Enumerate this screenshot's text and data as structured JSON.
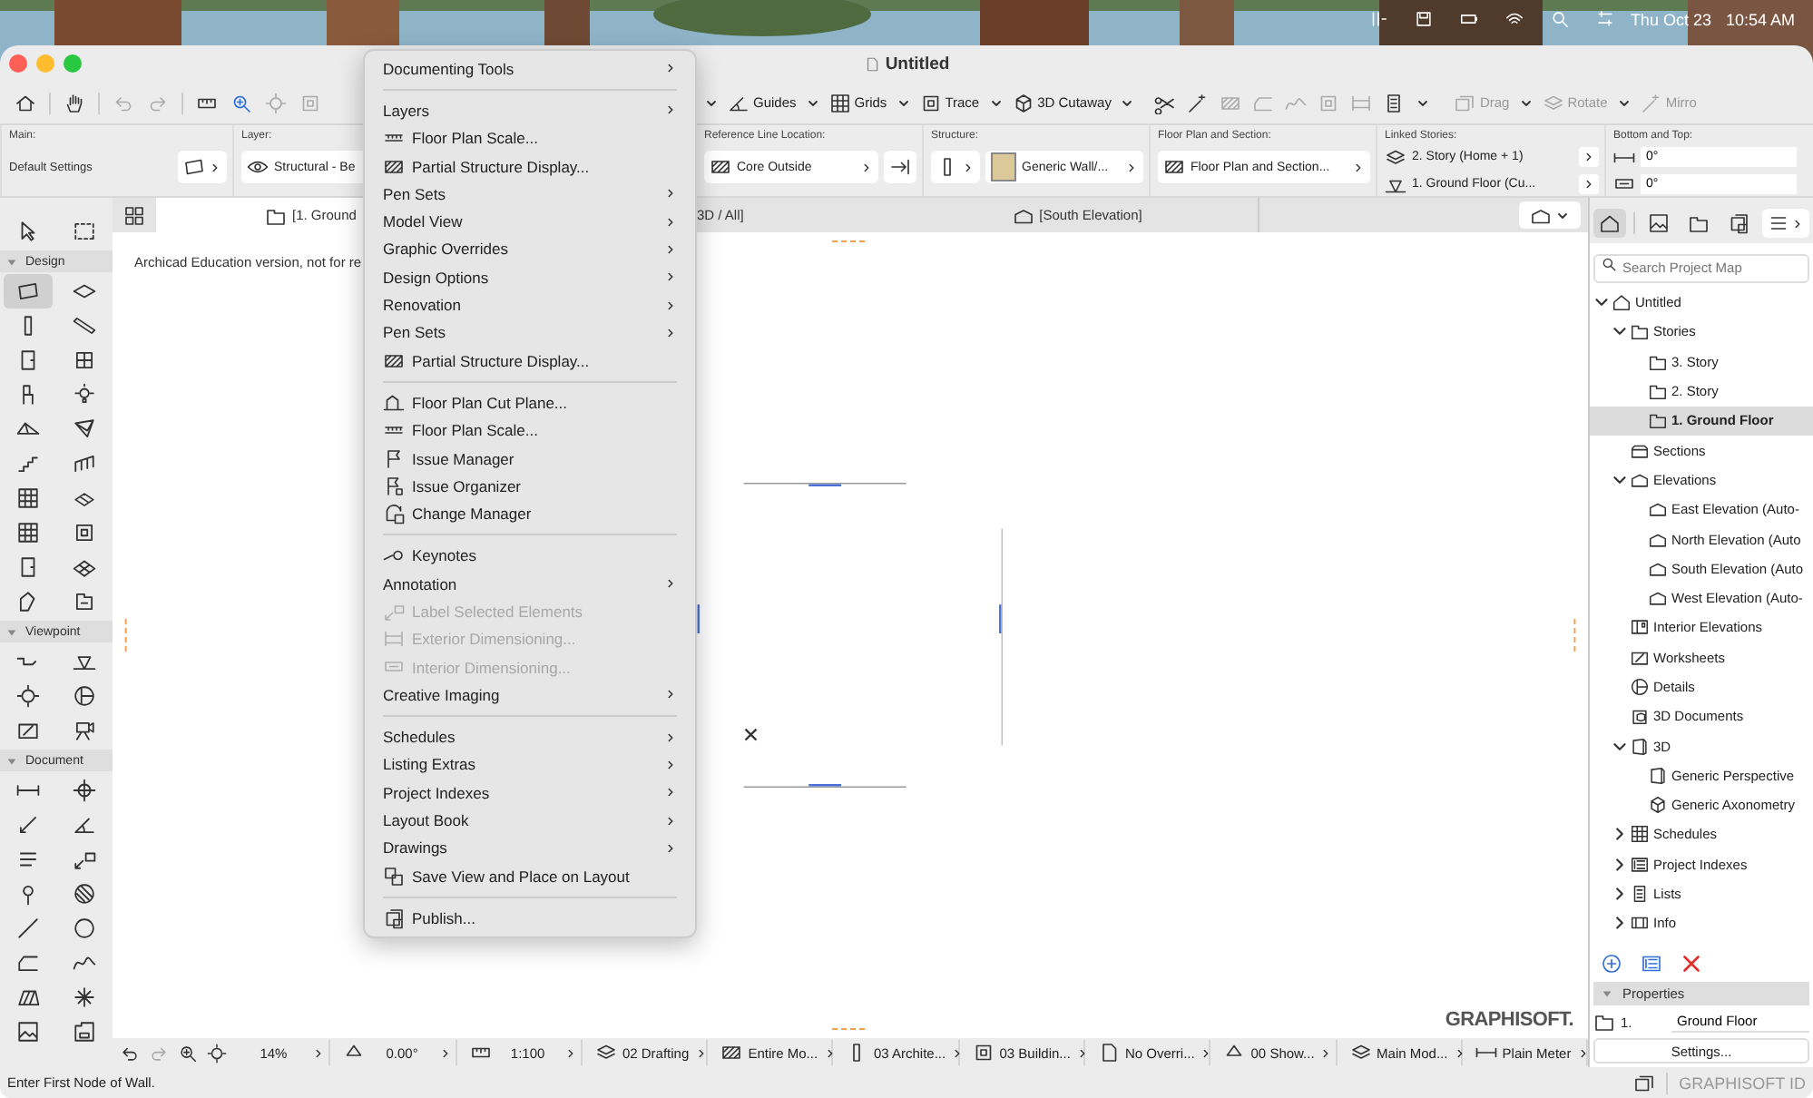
{
  "menubar": {
    "date": "Thu Oct 23",
    "time": "10:54 AM"
  },
  "window": {
    "title": "Untitled"
  },
  "toolbar": {
    "buttons": [
      {
        "label": "Guides",
        "disabled": false
      },
      {
        "label": "Grids",
        "disabled": false
      },
      {
        "label": "Trace",
        "disabled": false
      },
      {
        "label": "3D Cutaway",
        "disabled": false
      },
      {
        "label": "Drag",
        "disabled": true
      },
      {
        "label": "Rotate",
        "disabled": true
      },
      {
        "label": "Mirro",
        "disabled": true
      }
    ]
  },
  "info_box": [
    {
      "kind": "settings",
      "label": "Main:",
      "values": [
        "Default Settings"
      ]
    },
    {
      "kind": "field",
      "label": "Layer:",
      "values": [
        "Structural - Be"
      ]
    },
    {
      "kind": "field",
      "label": "Reference Line Location:",
      "values": [
        "Core Outside"
      ]
    },
    {
      "kind": "field",
      "label": "Structure:",
      "values": [
        "Generic Wall/..."
      ]
    },
    {
      "kind": "field",
      "label": "Floor Plan and Section:",
      "values": [
        "Floor Plan and Section..."
      ]
    },
    {
      "kind": "stack",
      "label": "Linked Stories:",
      "values": [
        "2. Story (Home + 1)",
        "1. Ground Floor (Cu..."
      ]
    },
    {
      "kind": "inputs",
      "label": "Bottom and Top:",
      "values": [
        "0°",
        "0°"
      ]
    }
  ],
  "tabs": [
    {
      "label": "[1. Ground",
      "selected": true
    },
    {
      "label": "3D / All]",
      "selected": false
    },
    {
      "label": "[South Elevation]",
      "selected": false
    }
  ],
  "toolbox": {
    "top_tools": [
      {
        "selected": false
      },
      {
        "selected": false
      }
    ],
    "sections": [
      {
        "title": "Design",
        "expanded": true,
        "tools": [
          {
            "selected": true
          },
          {
            "selected": false
          },
          {
            "selected": false
          },
          {
            "selected": false
          },
          {
            "selected": false
          },
          {
            "selected": false
          },
          {
            "selected": false
          },
          {
            "selected": false
          },
          {
            "selected": false
          },
          {
            "selected": false
          },
          {
            "selected": false
          },
          {
            "selected": false
          },
          {
            "selected": false
          },
          {
            "selected": false
          },
          {
            "selected": false
          },
          {
            "selected": false
          },
          {
            "selected": false
          },
          {
            "selected": false
          },
          {
            "selected": false
          },
          {
            "selected": false
          }
        ]
      },
      {
        "title": "Viewpoint",
        "expanded": true,
        "tools": [
          {
            "selected": false
          },
          {
            "selected": false
          },
          {
            "selected": false
          },
          {
            "selected": false
          },
          {
            "selected": false
          },
          {
            "selected": false
          }
        ]
      },
      {
        "title": "Document",
        "expanded": true,
        "tools": [
          {
            "selected": false
          },
          {
            "selected": false
          },
          {
            "selected": false
          },
          {
            "selected": false
          },
          {
            "selected": false
          },
          {
            "selected": false
          },
          {
            "selected": false
          },
          {
            "selected": false
          },
          {
            "selected": false
          },
          {
            "selected": false
          },
          {
            "selected": false
          },
          {
            "selected": false
          },
          {
            "selected": false
          },
          {
            "selected": false
          },
          {
            "selected": false
          },
          {
            "selected": false
          }
        ]
      }
    ]
  },
  "canvas": {
    "notice": "Archicad Education version, not for re",
    "logo": "GRAPHISOFT."
  },
  "view_bar": [
    "14%",
    "0.00°",
    "1:100",
    "02 Drafting",
    "Entire Mo...",
    "03 Archite...",
    "03 Buildin...",
    "No Overri...",
    "00 Show...",
    "Main Mod...",
    "Plain Meter"
  ],
  "menu": [
    {
      "kind": "submenu",
      "label": "Documenting Tools",
      "disabled": false
    },
    {
      "kind": "separator"
    },
    {
      "kind": "submenu",
      "label": "Layers",
      "disabled": false
    },
    {
      "kind": "command",
      "label": "Floor Plan Scale...",
      "disabled": false
    },
    {
      "kind": "command",
      "label": "Partial Structure Display...",
      "disabled": false
    },
    {
      "kind": "submenu",
      "label": "Pen Sets",
      "disabled": false
    },
    {
      "kind": "submenu",
      "label": "Model View",
      "disabled": false
    },
    {
      "kind": "submenu",
      "label": "Graphic Overrides",
      "disabled": false
    },
    {
      "kind": "submenu",
      "label": "Design Options",
      "disabled": false
    },
    {
      "kind": "submenu",
      "label": "Renovation",
      "disabled": false
    },
    {
      "kind": "submenu",
      "label": "Pen Sets",
      "disabled": false
    },
    {
      "kind": "command",
      "label": "Partial Structure Display...",
      "disabled": false
    },
    {
      "kind": "separator"
    },
    {
      "kind": "command",
      "label": "Floor Plan Cut Plane...",
      "disabled": false
    },
    {
      "kind": "command",
      "label": "Floor Plan Scale...",
      "disabled": false
    },
    {
      "kind": "command",
      "label": "Issue Manager",
      "disabled": false
    },
    {
      "kind": "command",
      "label": "Issue Organizer",
      "disabled": false
    },
    {
      "kind": "command",
      "label": "Change Manager",
      "disabled": false
    },
    {
      "kind": "separator"
    },
    {
      "kind": "command",
      "label": "Keynotes",
      "disabled": false
    },
    {
      "kind": "submenu",
      "label": "Annotation",
      "disabled": false
    },
    {
      "kind": "command",
      "label": "Label Selected Elements",
      "disabled": true
    },
    {
      "kind": "command",
      "label": "Exterior Dimensioning...",
      "disabled": true
    },
    {
      "kind": "command",
      "label": "Interior Dimensioning...",
      "disabled": true
    },
    {
      "kind": "submenu",
      "label": "Creative Imaging",
      "disabled": false
    },
    {
      "kind": "separator"
    },
    {
      "kind": "submenu",
      "label": "Schedules",
      "disabled": false
    },
    {
      "kind": "submenu",
      "label": "Listing Extras",
      "disabled": false
    },
    {
      "kind": "submenu",
      "label": "Project Indexes",
      "disabled": false
    },
    {
      "kind": "submenu",
      "label": "Layout Book",
      "disabled": false
    },
    {
      "kind": "submenu",
      "label": "Drawings",
      "disabled": false
    },
    {
      "kind": "command",
      "label": "Save View and Place on Layout",
      "disabled": false
    },
    {
      "kind": "separator"
    },
    {
      "kind": "command",
      "label": "Publish...",
      "disabled": false
    }
  ],
  "project_map": {
    "search": {
      "placeholder": "Search Project Map"
    },
    "tree": [
      {
        "kind": "project",
        "label": "Untitled",
        "expanded": true,
        "selected": false,
        "children": [
          {
            "kind": "folder",
            "label": "Stories",
            "expanded": true,
            "selected": false,
            "children": [
              {
                "kind": "story",
                "label": "3. Story",
                "selected": false
              },
              {
                "kind": "story",
                "label": "2. Story",
                "selected": false
              },
              {
                "kind": "story",
                "label": "1. Ground Floor",
                "selected": true
              }
            ]
          },
          {
            "kind": "sections",
            "label": "Sections",
            "selected": false
          },
          {
            "kind": "elevations",
            "label": "Elevations",
            "expanded": true,
            "selected": false,
            "children": [
              {
                "kind": "elevation",
                "label": "East Elevation (Auto-",
                "selected": false
              },
              {
                "kind": "elevation",
                "label": "North Elevation (Auto",
                "selected": false
              },
              {
                "kind": "elevation",
                "label": "South Elevation (Auto",
                "selected": false
              },
              {
                "kind": "elevation",
                "label": "West Elevation (Auto-",
                "selected": false
              }
            ]
          },
          {
            "kind": "interior",
            "label": "Interior Elevations",
            "selected": false
          },
          {
            "kind": "worksheet",
            "label": "Worksheets",
            "selected": false
          },
          {
            "kind": "detail",
            "label": "Details",
            "selected": false
          },
          {
            "kind": "doc3d",
            "label": "3D Documents",
            "selected": false
          },
          {
            "kind": "view3d",
            "label": "3D",
            "expanded": true,
            "selected": false,
            "children": [
              {
                "kind": "perspective",
                "label": "Generic Perspective",
                "selected": false
              },
              {
                "kind": "axonometry",
                "label": "Generic Axonometry",
                "selected": false
              }
            ]
          },
          {
            "kind": "schedules",
            "label": "Schedules",
            "expanded": false,
            "selected": false
          },
          {
            "kind": "indexes",
            "label": "Project Indexes",
            "expanded": false,
            "selected": false
          },
          {
            "kind": "lists",
            "label": "Lists",
            "expanded": false,
            "selected": false
          },
          {
            "kind": "info",
            "label": "Info",
            "expanded": false,
            "selected": false
          }
        ]
      }
    ]
  },
  "properties": {
    "title": "Properties",
    "expanded": true,
    "number": "1.",
    "name": "Ground Floor",
    "button": "Settings..."
  },
  "status_bar": {
    "message": "Enter First Node of Wall.",
    "account": "GRAPHISOFT ID"
  }
}
